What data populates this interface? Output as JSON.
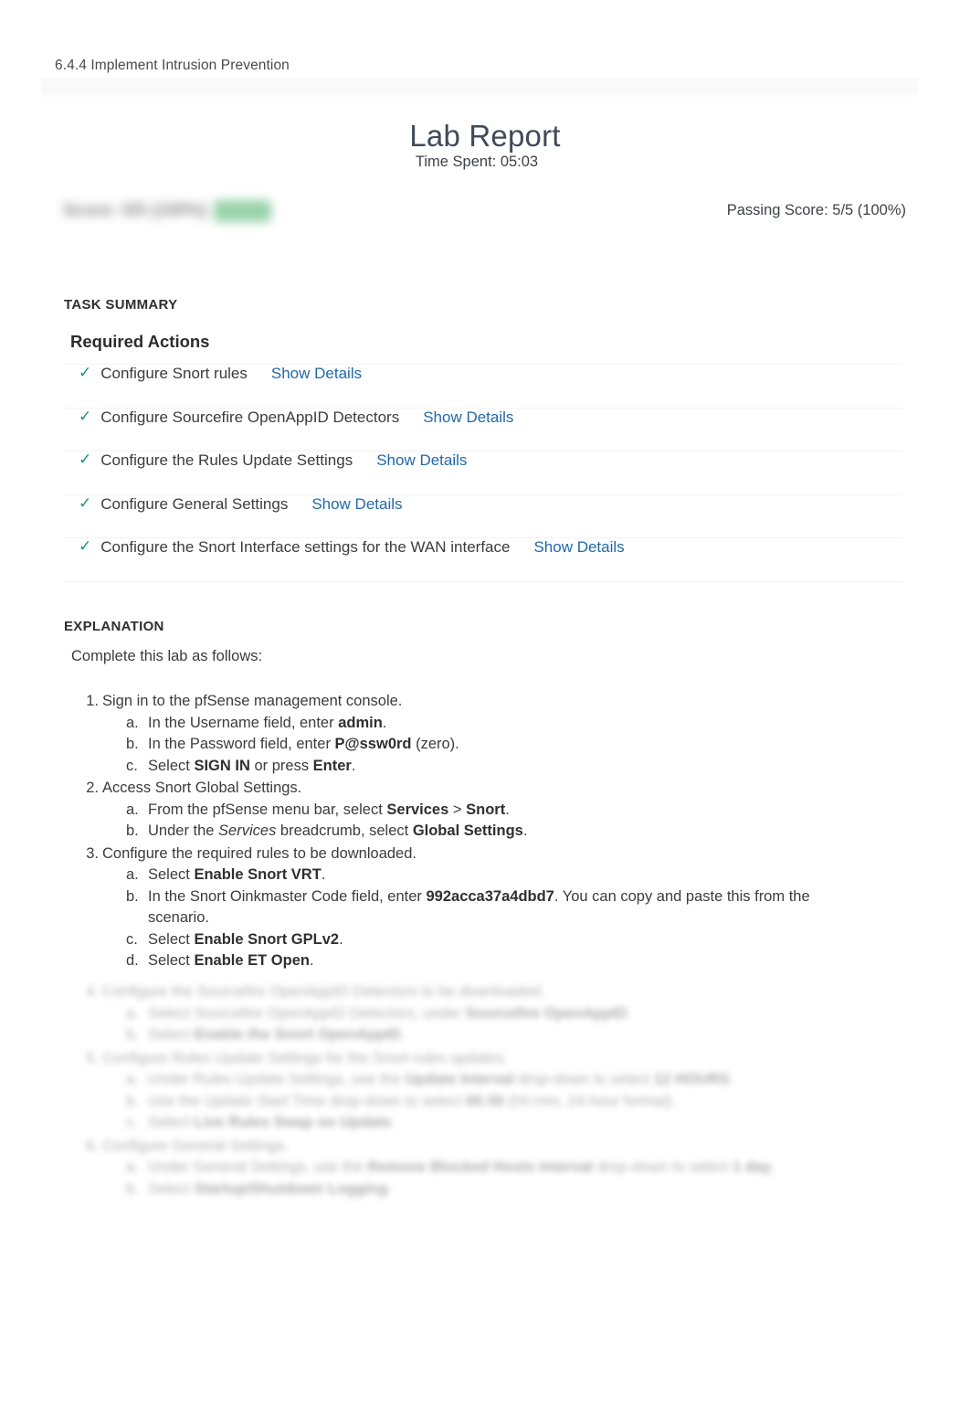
{
  "header": {
    "breadcrumb": "6.4.4 Implement Intrusion Prevention",
    "title": "Lab Report",
    "time_spent": "Time Spent: 05:03"
  },
  "score": {
    "redacted_score_text": "Score: 5/5 (100%)",
    "redacted_pass_badge": "Pass",
    "passing_score": "Passing Score: 5/5 (100%)"
  },
  "task_summary": {
    "section_label": "TASK SUMMARY",
    "required_actions_heading": "Required Actions",
    "check_icon": "check-icon",
    "show_details_label": "Show Details",
    "items": [
      {
        "label": "Configure Snort rules",
        "details_label": "Show Details",
        "status": "complete"
      },
      {
        "label": "Configure Sourcefire OpenAppID Detectors",
        "details_label": "Show Details",
        "status": "complete"
      },
      {
        "label": "Configure the Rules Update Settings",
        "details_label": "Show Details",
        "status": "complete"
      },
      {
        "label": "Configure General Settings",
        "details_label": "Show Details",
        "status": "complete"
      },
      {
        "label": "Configure the Snort Interface settings for the WAN interface",
        "details_label": "Show Details",
        "status": "complete"
      }
    ]
  },
  "explanation": {
    "section_label": "EXPLANATION",
    "intro": "Complete this lab as follows:",
    "steps": [
      {
        "num": "1.",
        "text": "Sign in to the pfSense management console.",
        "substeps": [
          {
            "let": "a.",
            "html": "In the Username field, enter <b>admin</b>."
          },
          {
            "let": "b.",
            "html": "In the Password field, enter <b>P@ssw0rd</b> (zero)."
          },
          {
            "let": "c.",
            "html": "Select <b>SIGN IN</b> or press <b>Enter</b>."
          }
        ]
      },
      {
        "num": "2.",
        "text": "Access Snort Global Settings.",
        "substeps": [
          {
            "let": "a.",
            "html": "From the pfSense menu bar, select <b>Services</b> &gt; <b>Snort</b>."
          },
          {
            "let": "b.",
            "html": "Under the <i>Services</i> breadcrumb, select <b>Global Settings</b>."
          }
        ]
      },
      {
        "num": "3.",
        "text": "Configure the required rules to be downloaded.",
        "substeps": [
          {
            "let": "a.",
            "html": "Select <b>Enable Snort VRT</b>."
          },
          {
            "let": "b.",
            "html": "In the Snort Oinkmaster Code field, enter <b>992acca37a4dbd7</b>. You can copy and paste this from the scenario."
          },
          {
            "let": "c.",
            "html": "Select <b>Enable Snort GPLv2</b>."
          },
          {
            "let": "d.",
            "html": "Select <b>Enable ET Open</b>."
          }
        ]
      }
    ],
    "redacted_steps": [
      {
        "num": "4.",
        "text": "Configure the Sourcefire OpenAppID Detectors to be downloaded.",
        "substeps": [
          {
            "let": "a.",
            "html": "Select Sourcefire OpenAppID Detectors, under <b>Sourcefire OpenAppID</b>."
          },
          {
            "let": "b.",
            "html": "Select <b>Enable the Snort OpenAppID</b>."
          }
        ]
      },
      {
        "num": "5.",
        "text": "Configure Rules Update Settings for the Snort rules updates.",
        "substeps": [
          {
            "let": "a.",
            "html": "Under Rules Update Settings, use the <b>Update Interval</b> drop-down to select <b>12 HOURS</b>."
          },
          {
            "let": "b.",
            "html": "Use the Update Start Time drop-down to select <b>00:30</b> (hh:mm, 24-hour format)."
          },
          {
            "let": "c.",
            "html": "Select <b>Live Rules Swap on Update</b>."
          }
        ]
      },
      {
        "num": "6.",
        "text": "Configure General Settings.",
        "substeps": [
          {
            "let": "a.",
            "html": "Under General Settings, use the <b>Remove Blocked Hosts Interval</b> drop-down to select <b>1 day</b>."
          },
          {
            "let": "b.",
            "html": "Select <b>Startup/Shutdown Logging</b>."
          }
        ]
      }
    ]
  },
  "colors": {
    "accent_link": "#2268a8",
    "check_green": "#1e8f7e",
    "title_slate": "#3f4a5a",
    "pass_badge_green": "#5cb87a"
  }
}
